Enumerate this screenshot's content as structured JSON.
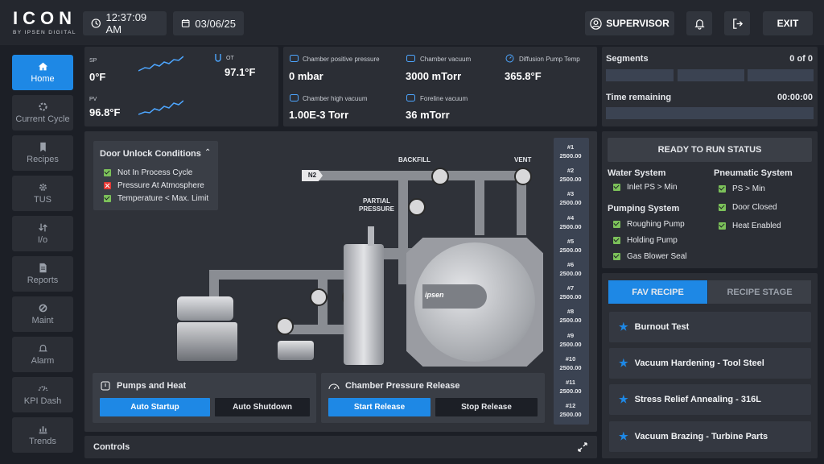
{
  "header": {
    "logo_text": "ICON",
    "logo_sub": "BY IPSEN DIGITAL",
    "time": "12:37:09 AM",
    "date": "03/06/25",
    "user": "SUPERVISOR",
    "exit_label": "EXIT"
  },
  "nav": [
    {
      "label": "Home",
      "icon": "home-icon",
      "active": true
    },
    {
      "label": "Current Cycle",
      "icon": "cycle-icon"
    },
    {
      "label": "Recipes",
      "icon": "bookmark-icon"
    },
    {
      "label": "TUS",
      "icon": "gear-icon"
    },
    {
      "label": "I/o",
      "icon": "arrows-icon"
    },
    {
      "label": "Reports",
      "icon": "report-icon"
    },
    {
      "label": "Maint",
      "icon": "wrench-icon"
    },
    {
      "label": "Alarm",
      "icon": "bell-icon"
    },
    {
      "label": "KPI Dash",
      "icon": "gauge-icon"
    },
    {
      "label": "Trends",
      "icon": "chart-icon"
    }
  ],
  "temps": {
    "sp_label": "SP",
    "sp_value": "0°F",
    "ot_label": "OT",
    "ot_value": "97.1°F",
    "pv_label": "PV",
    "pv_value": "96.8°F"
  },
  "pressures": [
    {
      "label": "Chamber positive pressure",
      "value": "0 mbar"
    },
    {
      "label": "Chamber vacuum",
      "value": "3000 mTorr"
    },
    {
      "label": "Diffusion Pump Temp",
      "value": "365.8°F"
    },
    {
      "label": "Chamber high vacuum",
      "value": "1.00E-3  Torr"
    },
    {
      "label": "Foreline vacuum",
      "value": "36 mTorr"
    }
  ],
  "segments": {
    "label": "Segments",
    "value": "0 of 0",
    "time_label": "Time remaining",
    "time_value": "00:00:00"
  },
  "door": {
    "title": "Door Unlock Conditions",
    "items": [
      {
        "label": "Not In Process Cycle",
        "ok": true
      },
      {
        "label": "Pressure At Atmosphere",
        "ok": false
      },
      {
        "label": "Temperature < Max. Limit",
        "ok": true
      }
    ]
  },
  "diagram": {
    "n2": "N2",
    "backfill": "BACKFILL",
    "vent": "VENT",
    "partial": "PARTIAL",
    "pressure": "PRESSURE",
    "brand": "ipsen"
  },
  "zones": [
    {
      "id": "#1",
      "v": "2500.00"
    },
    {
      "id": "#2",
      "v": "2500.00"
    },
    {
      "id": "#3",
      "v": "2500.00"
    },
    {
      "id": "#4",
      "v": "2500.00"
    },
    {
      "id": "#5",
      "v": "2500.00"
    },
    {
      "id": "#6",
      "v": "2500.00"
    },
    {
      "id": "#7",
      "v": "2500.00"
    },
    {
      "id": "#8",
      "v": "2500.00"
    },
    {
      "id": "#9",
      "v": "2500.00"
    },
    {
      "id": "#10",
      "v": "2500.00"
    },
    {
      "id": "#11",
      "v": "2500.00"
    },
    {
      "id": "#12",
      "v": "2500.00"
    }
  ],
  "pumps": {
    "title": "Pumps and Heat",
    "startup": "Auto Startup",
    "shutdown": "Auto Shutdown"
  },
  "release": {
    "title": "Chamber Pressure Release",
    "start": "Start Release",
    "stop": "Stop Release"
  },
  "controls": {
    "label": "Controls"
  },
  "ready": {
    "title": "READY TO RUN STATUS",
    "water_title": "Water System",
    "water_items": [
      "Inlet PS > Min"
    ],
    "pumping_title": "Pumping System",
    "pumping_items": [
      "Roughing Pump",
      "Holding Pump",
      "Gas Blower Seal"
    ],
    "pneumatic_title": "Pneumatic System",
    "pneumatic_items": [
      "PS > Min",
      "Door Closed",
      "Heat Enabled"
    ]
  },
  "recipes": {
    "tab_fav": "FAV RECIPE",
    "tab_stage": "RECIPE STAGE",
    "items": [
      "Burnout Test",
      "Vacuum Hardening - Tool Steel",
      "Stress Relief Annealing - 316L",
      "Vacuum Brazing - Turbine Parts"
    ]
  },
  "colors": {
    "accent": "#1e88e5",
    "ok": "#7cc15a",
    "fail": "#e53935"
  }
}
